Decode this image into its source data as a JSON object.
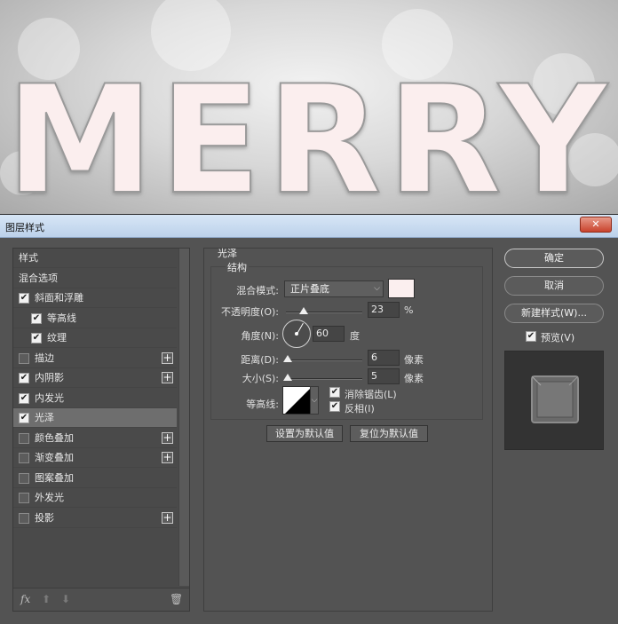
{
  "canvas": {
    "word": "MERRY"
  },
  "dialog": {
    "title": "图层样式",
    "close_label": "✕"
  },
  "style_list": {
    "items": [
      {
        "label": "样式",
        "checkbox": false,
        "checked": false,
        "indent": 0,
        "plus": false,
        "selected": false
      },
      {
        "label": "混合选项",
        "checkbox": false,
        "checked": false,
        "indent": 0,
        "plus": false,
        "selected": false
      },
      {
        "label": "斜面和浮雕",
        "checkbox": true,
        "checked": true,
        "indent": 0,
        "plus": false,
        "selected": false
      },
      {
        "label": "等高线",
        "checkbox": true,
        "checked": true,
        "indent": 1,
        "plus": false,
        "selected": false
      },
      {
        "label": "纹理",
        "checkbox": true,
        "checked": true,
        "indent": 1,
        "plus": false,
        "selected": false
      },
      {
        "label": "描边",
        "checkbox": true,
        "checked": false,
        "indent": 0,
        "plus": true,
        "selected": false
      },
      {
        "label": "内阴影",
        "checkbox": true,
        "checked": true,
        "indent": 0,
        "plus": true,
        "selected": false
      },
      {
        "label": "内发光",
        "checkbox": true,
        "checked": true,
        "indent": 0,
        "plus": false,
        "selected": false
      },
      {
        "label": "光泽",
        "checkbox": true,
        "checked": true,
        "indent": 0,
        "plus": false,
        "selected": true
      },
      {
        "label": "颜色叠加",
        "checkbox": true,
        "checked": false,
        "indent": 0,
        "plus": true,
        "selected": false
      },
      {
        "label": "渐变叠加",
        "checkbox": true,
        "checked": false,
        "indent": 0,
        "plus": true,
        "selected": false
      },
      {
        "label": "图案叠加",
        "checkbox": true,
        "checked": false,
        "indent": 0,
        "plus": false,
        "selected": false
      },
      {
        "label": "外发光",
        "checkbox": true,
        "checked": false,
        "indent": 0,
        "plus": false,
        "selected": false
      },
      {
        "label": "投影",
        "checkbox": true,
        "checked": false,
        "indent": 0,
        "plus": true,
        "selected": false
      }
    ],
    "footer": {
      "fx": "fx",
      "up": "⬆",
      "down": "⬇",
      "trash": "🗑"
    }
  },
  "satin": {
    "section_title": "光泽",
    "group_title": "结构",
    "blend_mode_label": "混合模式:",
    "blend_mode_value": "正片叠底",
    "blend_color": "#fbefef",
    "opacity_label": "不透明度(O):",
    "opacity_value": "23",
    "opacity_unit": "%",
    "opacity_fraction": 0.23,
    "angle_label": "角度(N):",
    "angle_value": "60",
    "angle_unit": "度",
    "distance_label": "距离(D):",
    "distance_value": "6",
    "distance_unit": "像素",
    "distance_fraction": 0.024,
    "size_label": "大小(S):",
    "size_value": "5",
    "size_unit": "像素",
    "size_fraction": 0.02,
    "contour_label": "等高线:",
    "antialias_label": "消除锯齿(L)",
    "antialias_checked": true,
    "invert_label": "反相(I)",
    "invert_checked": true,
    "make_default": "设置为默认值",
    "reset_default": "复位为默认值"
  },
  "actions": {
    "ok": "确定",
    "cancel": "取消",
    "new_style": "新建样式(W)...",
    "preview_label": "预览(V)",
    "preview_checked": true
  }
}
